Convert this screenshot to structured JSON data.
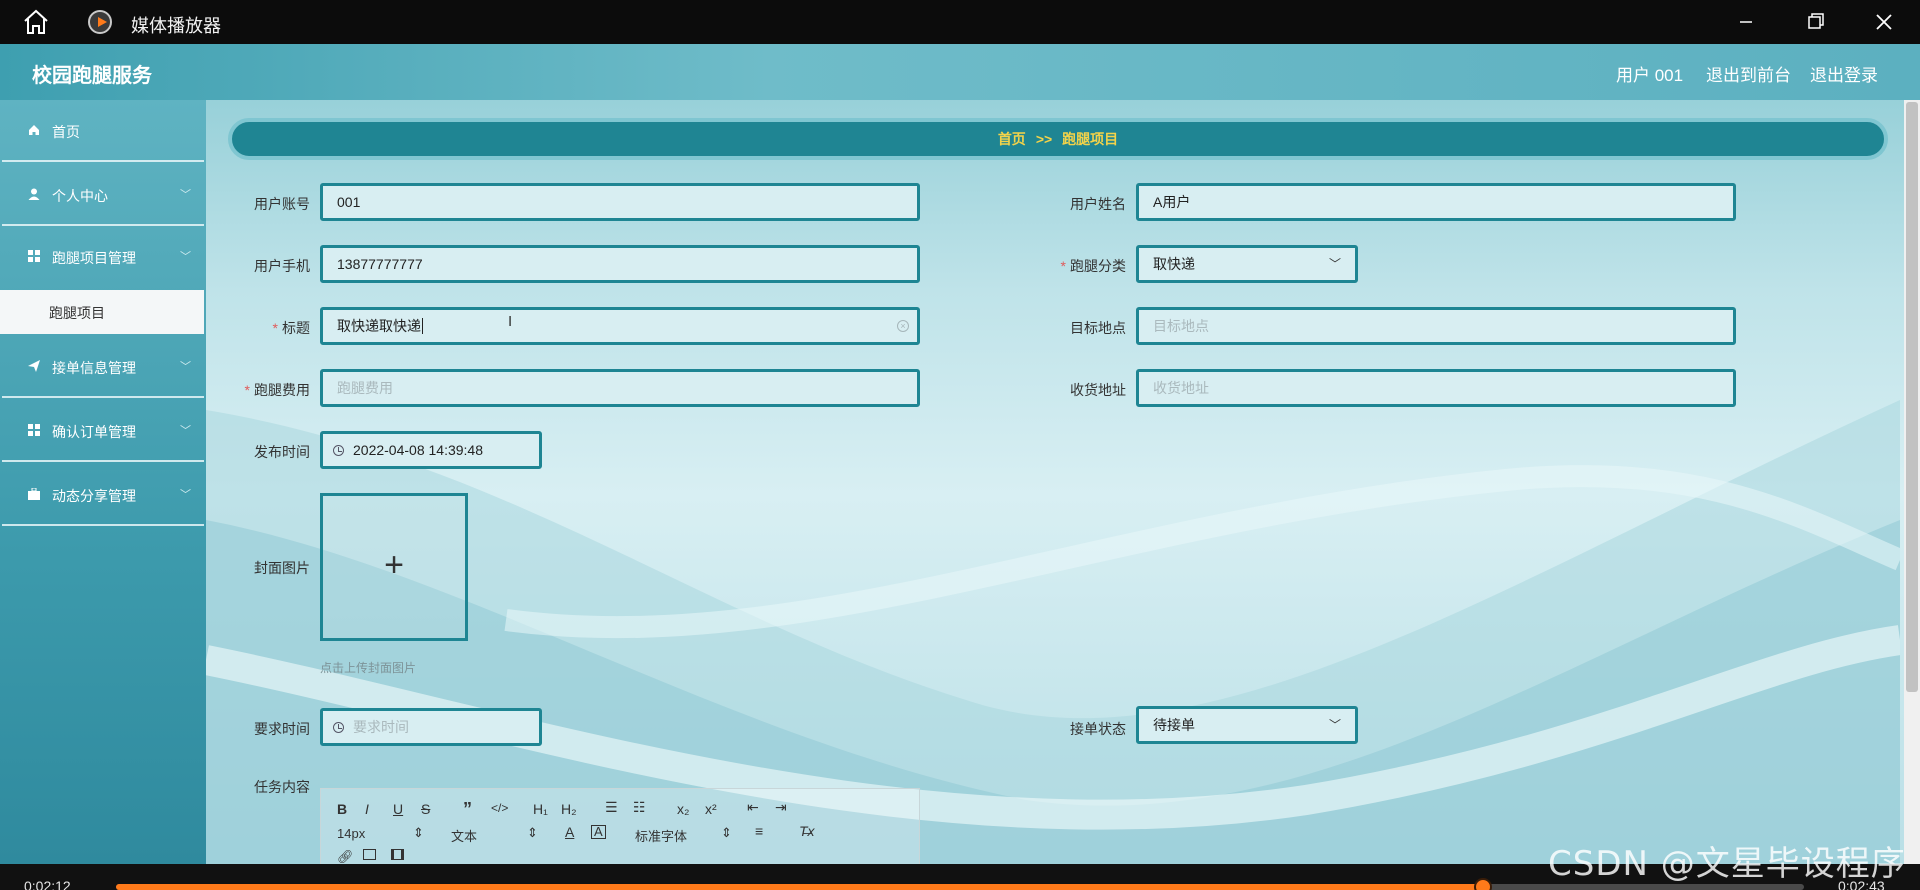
{
  "player": {
    "title": "媒体播放器",
    "current_time": "0:02:12",
    "total_time": "0:02:43",
    "progress_fraction": 0.81
  },
  "header": {
    "brand": "校园跑腿服务",
    "user": "用户 001",
    "to_front": "退出到前台",
    "logout": "退出登录"
  },
  "sidebar": {
    "items": [
      {
        "label": "首页",
        "icon": "home-icon"
      },
      {
        "label": "个人中心",
        "icon": "user-icon"
      },
      {
        "label": "跑腿项目管理",
        "icon": "grid-icon"
      },
      {
        "label": "接单信息管理",
        "icon": "send-icon"
      },
      {
        "label": "确认订单管理",
        "icon": "grid-icon"
      },
      {
        "label": "动态分享管理",
        "icon": "briefcase-icon"
      }
    ],
    "sub_item": "跑腿项目"
  },
  "breadcrumb": {
    "home": "首页",
    "separator": ">>",
    "current": "跑腿项目"
  },
  "form": {
    "account_label": "用户账号",
    "account_value": "001",
    "name_label": "用户姓名",
    "name_value": "A用户",
    "phone_label": "用户手机",
    "phone_value": "13877777777",
    "category_label": "跑腿分类",
    "category_value": "取快递",
    "title_label": "标题",
    "title_value": "取快递取快递",
    "target_label": "目标地点",
    "target_placeholder": "目标地点",
    "fee_label": "跑腿费用",
    "fee_placeholder": "跑腿费用",
    "address_label": "收货地址",
    "address_placeholder": "收货地址",
    "publish_label": "发布时间",
    "publish_value": "2022-04-08 14:39:48",
    "cover_label": "封面图片",
    "cover_hint": "点击上传封面图片",
    "require_label": "要求时间",
    "require_placeholder": "要求时间",
    "status_label": "接单状态",
    "status_value": "待接单",
    "task_label": "任务内容"
  },
  "editor": {
    "font_size": "14px",
    "paragraph": "文本",
    "font_family": "标准字体"
  },
  "watermark": "CSDN @文星毕设程序"
}
